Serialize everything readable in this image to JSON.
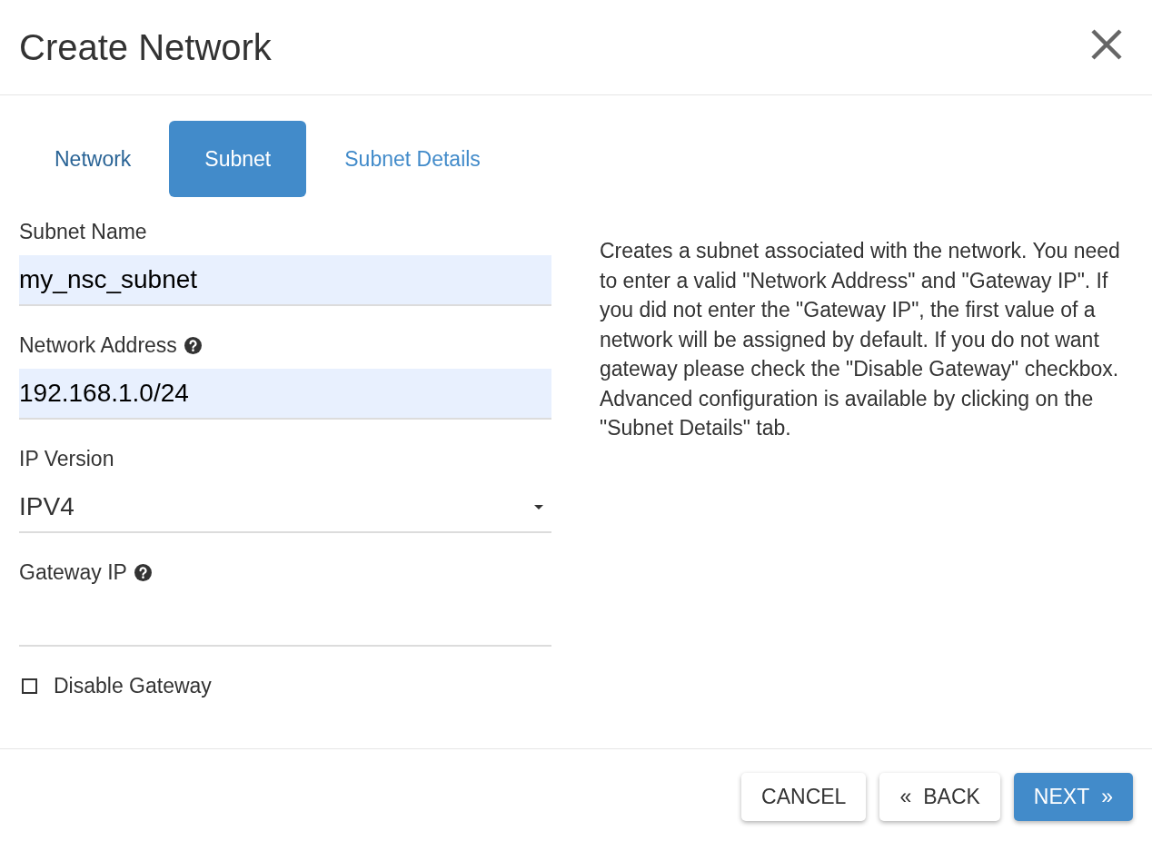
{
  "dialog": {
    "title": "Create Network"
  },
  "tabs": [
    {
      "label": "Network",
      "selected": false,
      "color": "#2a6496"
    },
    {
      "label": "Subnet",
      "selected": true,
      "color": "#428bca"
    },
    {
      "label": "Subnet Details",
      "selected": false,
      "color": "#428bca"
    }
  ],
  "form": {
    "fields": [
      {
        "kind": "text",
        "label": "Subnet Name",
        "help": false,
        "value": "my_nsc_subnet",
        "highlighted": true
      },
      {
        "kind": "text",
        "label": "Network Address",
        "help": true,
        "value": "192.168.1.0/24",
        "highlighted": true
      },
      {
        "kind": "select",
        "label": "IP Version",
        "help": false,
        "value": "IPV4",
        "highlighted": false
      },
      {
        "kind": "text",
        "label": "Gateway IP",
        "help": true,
        "highlighted": false
      },
      {
        "kind": "checkbox",
        "label": "Disable Gateway",
        "help": false,
        "checked": false,
        "highlighted": false
      }
    ]
  },
  "description": "Creates a subnet associated with the network. You need to enter a valid \"Network Address\" and \"Gateway IP\". If you did not enter the \"Gateway IP\", the first value of a network will be assigned by default. If you do not want gateway please check the \"Disable Gateway\" checkbox. Advanced configuration is available by clicking on the \"Subnet Details\" tab.",
  "footer": {
    "buttons": [
      {
        "label": "CANCEL",
        "kind": "default"
      },
      {
        "label": "BACK",
        "kind": "default",
        "icon_before": "«"
      },
      {
        "label": "NEXT",
        "kind": "primary",
        "icon_after": "»"
      }
    ]
  }
}
